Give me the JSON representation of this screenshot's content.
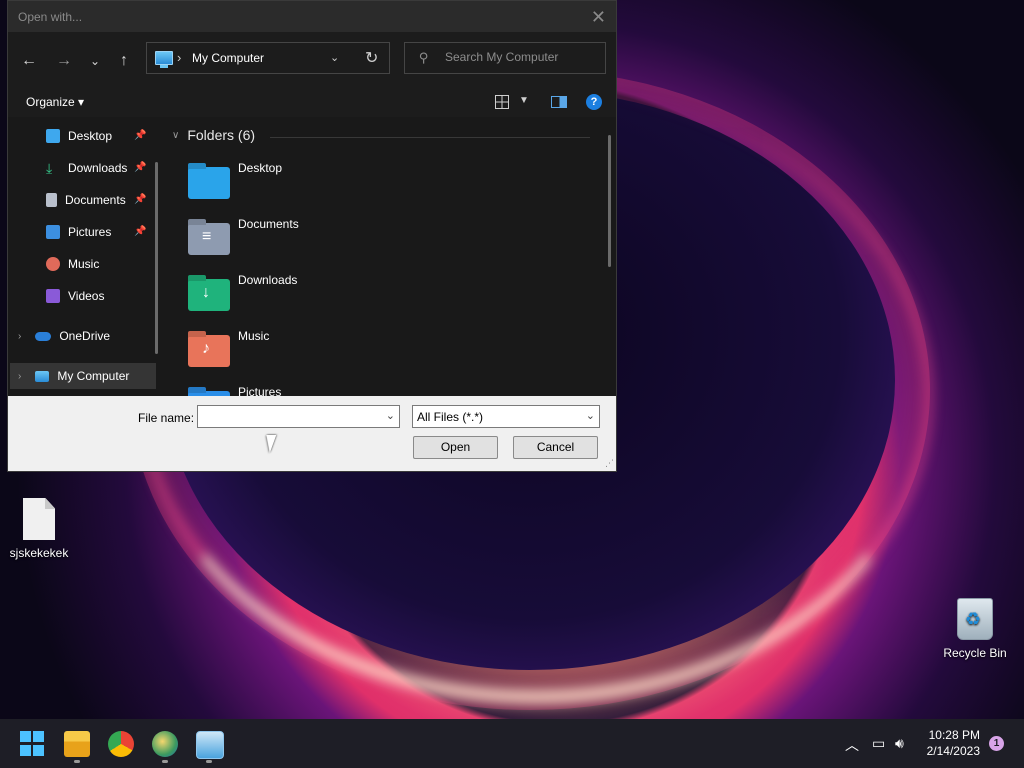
{
  "dialog": {
    "title": "Open with...",
    "address": {
      "location": "My Computer"
    },
    "search": {
      "placeholder": "Search My Computer"
    },
    "toolbar": {
      "organize": "Organize"
    },
    "nav_pane": {
      "items": [
        {
          "label": "Desktop",
          "icon": "desktop-icon",
          "pinned": true
        },
        {
          "label": "Downloads",
          "icon": "download-icon",
          "pinned": true
        },
        {
          "label": "Documents",
          "icon": "document-icon",
          "pinned": true
        },
        {
          "label": "Pictures",
          "icon": "pictures-icon",
          "pinned": true
        },
        {
          "label": "Music",
          "icon": "music-icon",
          "pinned": false
        },
        {
          "label": "Videos",
          "icon": "videos-icon",
          "pinned": false
        },
        {
          "label": "OneDrive",
          "icon": "cloud-icon",
          "pinned": false
        },
        {
          "label": "My Computer",
          "icon": "computer-icon",
          "pinned": false,
          "selected": true
        }
      ]
    },
    "content": {
      "group_title": "Folders (6)",
      "folders": [
        {
          "label": "Desktop",
          "icon": "desktop-folder-icon",
          "color": "#2aa4ea"
        },
        {
          "label": "Documents",
          "icon": "documents-folder-icon",
          "color": "#8e9bb0"
        },
        {
          "label": "Downloads",
          "icon": "downloads-folder-icon",
          "color": "#1fb37c"
        },
        {
          "label": "Music",
          "icon": "music-folder-icon",
          "color": "#e8745a"
        },
        {
          "label": "Pictures",
          "icon": "pictures-folder-icon",
          "color": "#2a8ee8"
        }
      ]
    },
    "bottom": {
      "file_name_label": "File name:",
      "file_name_value": "",
      "file_type": "All Files (*.*)",
      "open_button": "Open",
      "cancel_button": "Cancel"
    }
  },
  "desktop": {
    "icons": [
      {
        "label": "sjskekekek",
        "icon": "file-icon"
      },
      {
        "label": "Recycle Bin",
        "icon": "recycle-bin-icon"
      }
    ]
  },
  "taskbar": {
    "apps": [
      "start-icon",
      "file-explorer-icon",
      "chrome-icon",
      "edge-canary-icon",
      "control-panel-icon"
    ],
    "time": "10:28 PM",
    "date": "2/14/2023",
    "notifications": "1"
  }
}
